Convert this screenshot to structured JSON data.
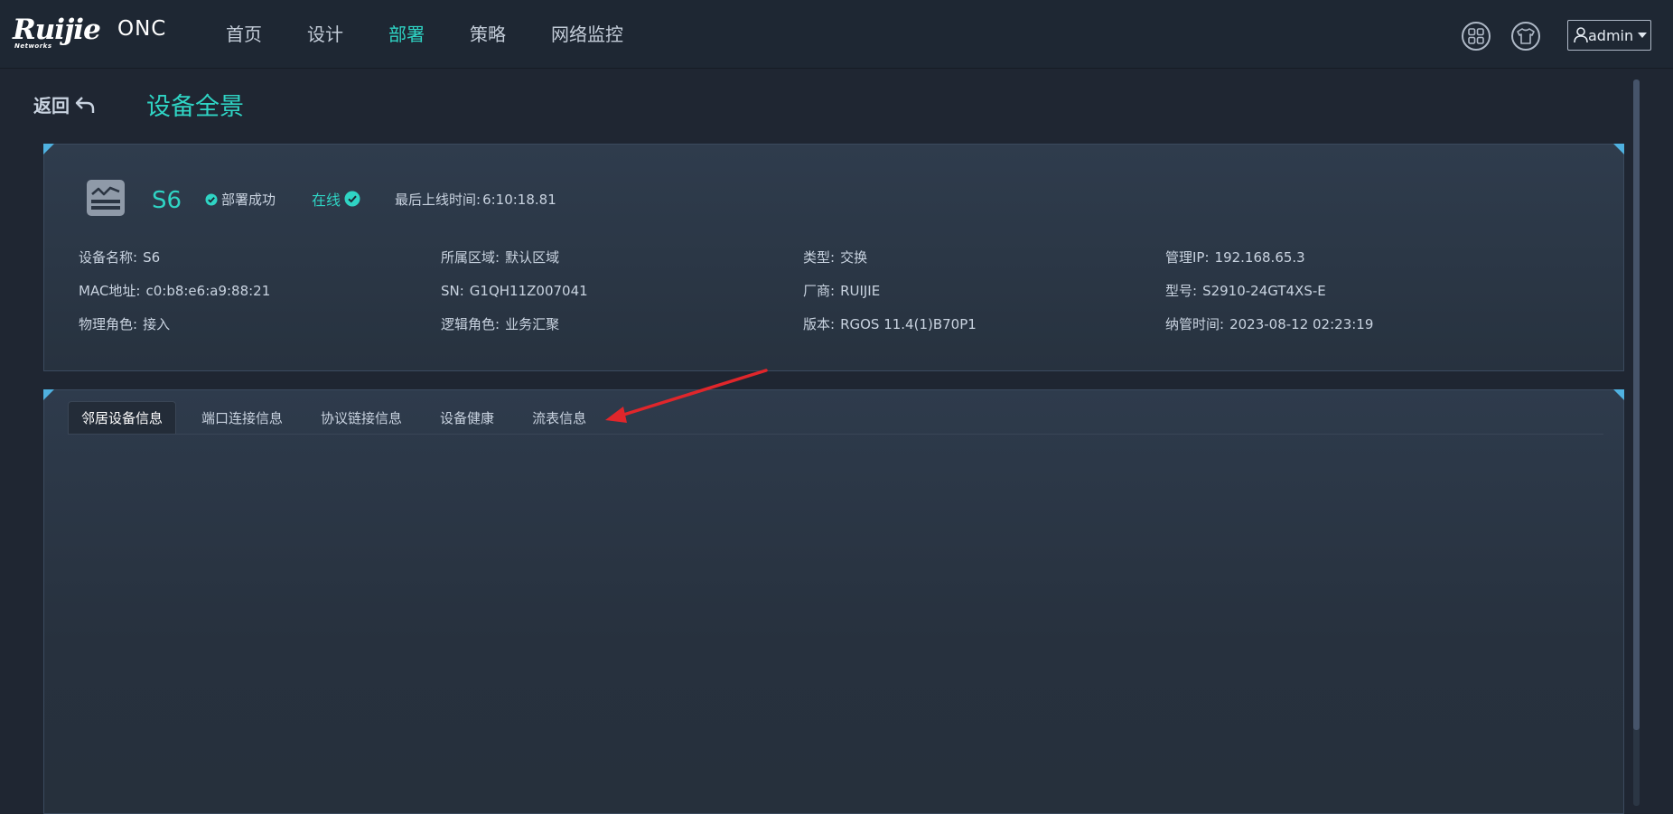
{
  "brand": {
    "logo_text": "Ruijie",
    "logo_sub": "Networks",
    "product": "ONC"
  },
  "nav": {
    "items": [
      {
        "label": "首页",
        "active": false
      },
      {
        "label": "设计",
        "active": false
      },
      {
        "label": "部署",
        "active": true
      },
      {
        "label": "策略",
        "active": false
      },
      {
        "label": "网络监控",
        "active": false
      }
    ]
  },
  "header_icons": {
    "apps": "grid-apps-icon",
    "theme": "tshirt-icon",
    "user": "user-icon"
  },
  "user": {
    "name": "admin"
  },
  "page": {
    "back_label": "返回",
    "title": "设备全景"
  },
  "device": {
    "name": "S6",
    "deploy_status": "部署成功",
    "online_status": "在线",
    "last_online_label": "最后上线时间:",
    "last_online_value": "6:10:18.81",
    "fields": [
      [
        {
          "label": "设备名称:",
          "value": "S6"
        },
        {
          "label": "所属区域:",
          "value": "默认区域"
        },
        {
          "label": "类型:",
          "value": "交换"
        },
        {
          "label": "管理IP:",
          "value": "192.168.65.3"
        }
      ],
      [
        {
          "label": "MAC地址:",
          "value": "c0:b8:e6:a9:88:21"
        },
        {
          "label": "SN:",
          "value": "G1QH11Z007041"
        },
        {
          "label": "厂商:",
          "value": "RUIJIE"
        },
        {
          "label": "型号:",
          "value": "S2910-24GT4XS-E"
        }
      ],
      [
        {
          "label": "物理角色:",
          "value": "接入"
        },
        {
          "label": "逻辑角色:",
          "value": "业务汇聚"
        },
        {
          "label": "版本:",
          "value": "RGOS 11.4(1)B70P1"
        },
        {
          "label": "纳管时间:",
          "value": "2023-08-12 02:23:19"
        }
      ]
    ]
  },
  "tabs": [
    {
      "label": "邻居设备信息",
      "active": true
    },
    {
      "label": "端口连接信息",
      "active": false
    },
    {
      "label": "协议链接信息",
      "active": false
    },
    {
      "label": "设备健康",
      "active": false
    },
    {
      "label": "流表信息",
      "active": false
    }
  ],
  "colors": {
    "accent": "#2fd4c4",
    "annotation": "#e0262b",
    "corner": "#4fb1e0"
  }
}
